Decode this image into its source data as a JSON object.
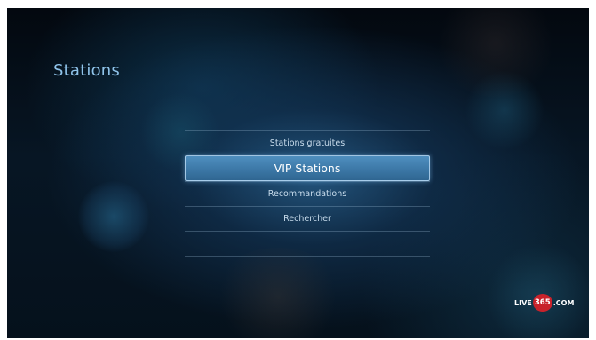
{
  "screen": {
    "title": "Stations"
  },
  "menu": {
    "items": [
      {
        "label": "Stations gratuites",
        "selected": false
      },
      {
        "label": "VIP Stations",
        "selected": true
      },
      {
        "label": "Recommandations",
        "selected": false
      },
      {
        "label": "Rechercher",
        "selected": false
      },
      {
        "label": "",
        "selected": false
      }
    ]
  },
  "logo": {
    "prefix": "LIVE",
    "number": "365",
    "suffix": ".COM"
  },
  "colors": {
    "accent": "#4f8fbf",
    "title": "#8fc3ea",
    "logo_badge": "#c8222b"
  }
}
